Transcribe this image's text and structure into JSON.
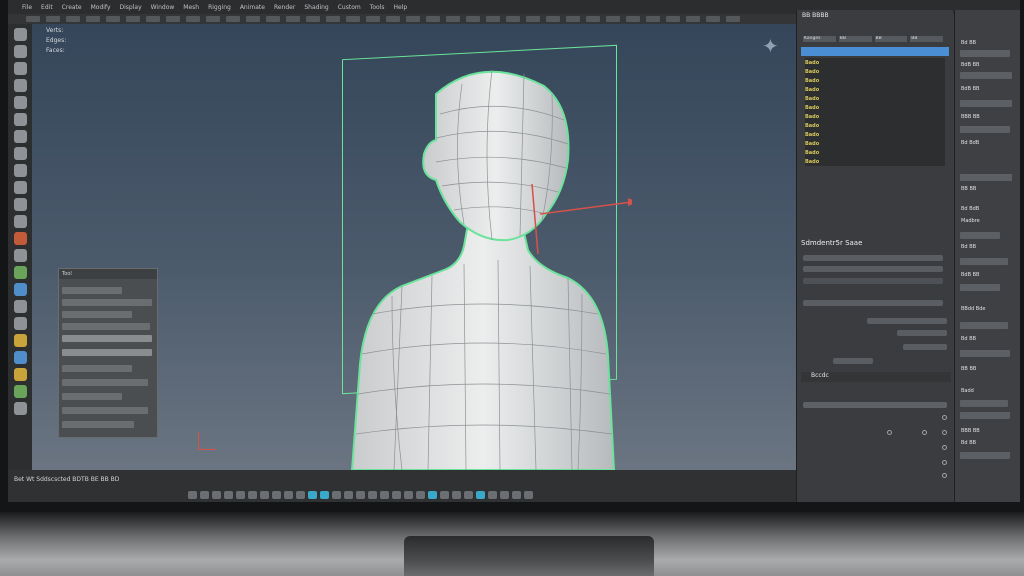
{
  "menubar": {
    "items": [
      "File",
      "Edit",
      "Create",
      "Modify",
      "Display",
      "Window",
      "Mesh",
      "Rigging",
      "Animate",
      "Render",
      "Shading",
      "Custom",
      "Tools",
      "Help"
    ]
  },
  "viewport": {
    "info_lines": [
      "Verts:",
      "Edges:",
      "Faces:"
    ],
    "gizmo_axis_colors": {
      "x": "#d5524a",
      "selection": "#6be39a"
    }
  },
  "float_panel": {
    "title": "Tool"
  },
  "bottom_bar": {
    "text": "Bet Wt Sddscscted BDTB BE BB BD"
  },
  "right_panel": {
    "header": "BB BBBB",
    "tabs": [
      "Kanges",
      "BB",
      "BB",
      "BB"
    ],
    "grid_rows": [
      "Bado",
      "Bado",
      "Bado",
      "Bado",
      "Bado",
      "Bado",
      "Bado",
      "Bado",
      "Bado",
      "Bado",
      "Bado",
      "Bado"
    ],
    "section_title": "Sdmdentr5r Saae",
    "section3_title": "Bccdc"
  },
  "far_right_panel": {
    "labels": [
      "Bd BB",
      "BdB BB",
      "BdB BB",
      "BBB BB",
      "Bd BdB",
      "BB BB",
      "Bd BdB",
      "Madbre",
      "Bd BB",
      "BdB BB",
      "BBdd Bde",
      "Bd BB",
      "BB BB",
      "Badd",
      "BBB BB",
      "Bd BB"
    ]
  }
}
